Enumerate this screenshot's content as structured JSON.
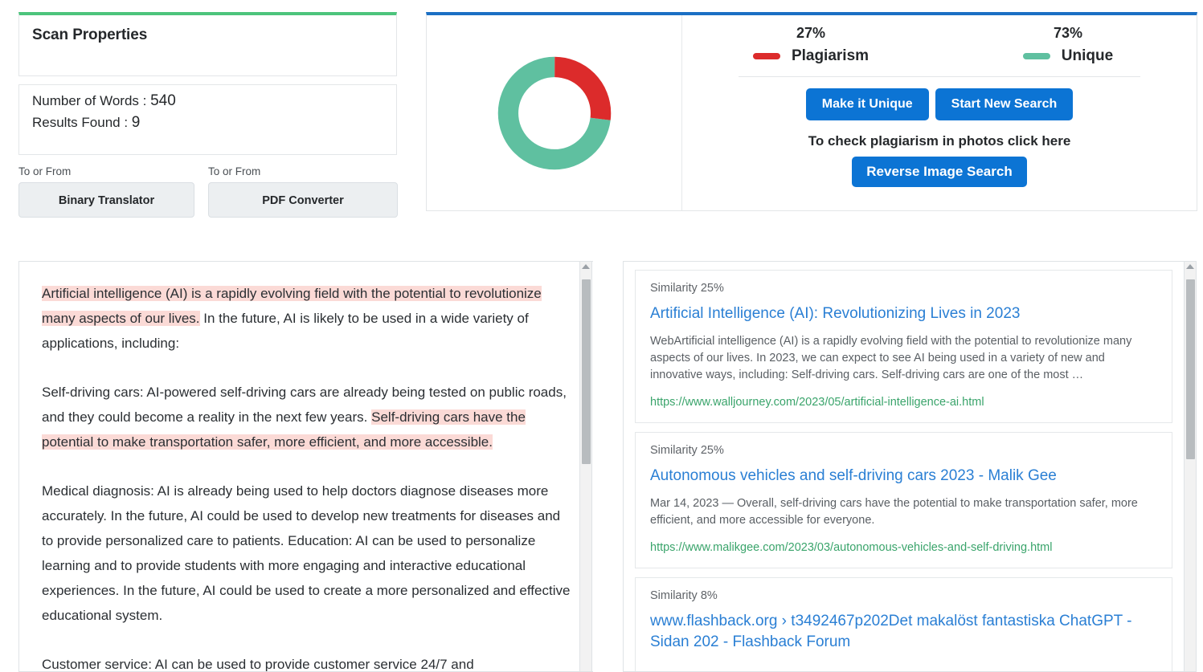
{
  "scan_properties": {
    "title": "Scan Properties",
    "words_label": "Number of Words :",
    "words_value": "540",
    "results_label": "Results Found :",
    "results_value": "9"
  },
  "tools": [
    {
      "label": "To or From",
      "button": "Binary Translator"
    },
    {
      "label": "To or From",
      "button": "PDF Converter"
    }
  ],
  "summary": {
    "plagiarism_pct": "27%",
    "plagiarism_label": "Plagiarism",
    "unique_pct": "73%",
    "unique_label": "Unique",
    "make_unique_button": "Make it Unique",
    "new_search_button": "Start New Search",
    "photos_note": "To check plagiarism in photos click here",
    "reverse_image_button": "Reverse Image Search",
    "colors": {
      "plagiarism": "#dc2b2b",
      "unique": "#5fc0a0",
      "accent_blue": "#0c74d4",
      "card_top_blue": "#1b6fc4",
      "card_top_green": "#4cc47c"
    }
  },
  "chart_data": {
    "type": "pie",
    "title": "",
    "categories": [
      "Plagiarism",
      "Unique"
    ],
    "values": [
      27,
      73
    ],
    "colors": [
      "#dc2b2b",
      "#5fc0a0"
    ],
    "unit": "%",
    "donut": true,
    "legend": "right"
  },
  "document": {
    "paragraphs": [
      {
        "runs": [
          {
            "text": "Artificial intelligence (AI) is a rapidly evolving field with the potential to revolutionize many aspects of our lives.",
            "highlight": true
          },
          {
            "text": " In the future, AI is likely to be used in a wide variety of applications, including:",
            "highlight": false
          }
        ]
      },
      {
        "runs": [
          {
            "text": "Self-driving cars: AI-powered self-driving cars are already being tested on public roads, and they could become a reality in the next few years. ",
            "highlight": false
          },
          {
            "text": "Self-driving cars have the potential to make transportation safer, more efficient, and more accessible.",
            "highlight": true
          }
        ]
      },
      {
        "runs": [
          {
            "text": "Medical diagnosis: AI is already being used to help doctors diagnose diseases more accurately. In the future, AI could be used to develop new treatments for diseases and to provide personalized care to patients. Education: AI can be used to personalize learning and to provide students with more engaging and interactive educational experiences. In the future, AI could be used to create a more personalized and effective educational system.",
            "highlight": false
          }
        ]
      },
      {
        "runs": [
          {
            "text": "Customer service: AI can be used to provide customer service 24/7 and",
            "highlight": false
          }
        ]
      }
    ]
  },
  "results": [
    {
      "similarity": "Similarity 25%",
      "title": "Artificial Intelligence (AI): Revolutionizing Lives in 2023",
      "snippet": "WebArtificial intelligence (AI) is a rapidly evolving field with the potential to revolutionize many aspects of our lives. In 2023, we can expect to see AI being used in a variety of new and innovative ways, including: Self-driving cars. Self-driving cars are one of the most …",
      "url": "https://www.walljourney.com/2023/05/artificial-intelligence-ai.html"
    },
    {
      "similarity": "Similarity 25%",
      "title": "Autonomous vehicles and self-driving cars 2023 - Malik Gee",
      "snippet": "Mar 14, 2023 — Overall, self-driving cars have the potential to make transportation safer, more efficient, and more accessible for everyone.",
      "url": "https://www.malikgee.com/2023/03/autonomous-vehicles-and-self-driving.html"
    },
    {
      "similarity": "Similarity 8%",
      "title": "www.flashback.org › t3492467p202Det makalöst fantastiska ChatGPT - Sidan 202 - Flashback Forum",
      "snippet": "",
      "url": ""
    }
  ]
}
